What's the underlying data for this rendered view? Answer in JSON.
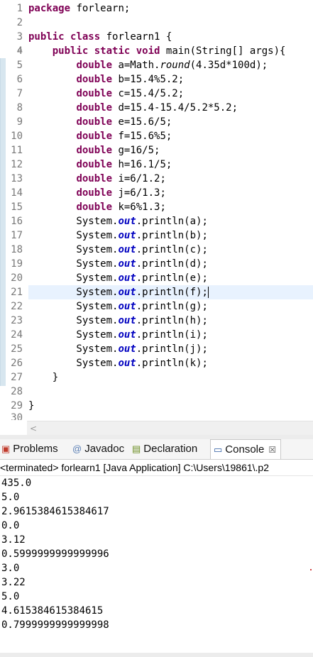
{
  "editor": {
    "line_numbers": [
      "1",
      "2",
      "3",
      "4",
      "5",
      "6",
      "7",
      "8",
      "9",
      "10",
      "11",
      "12",
      "13",
      "14",
      "15",
      "16",
      "17",
      "18",
      "19",
      "20",
      "21",
      "22",
      "23",
      "24",
      "25",
      "26",
      "27",
      "28",
      "29",
      "30"
    ]
  },
  "tabs": {
    "problems": "Problems",
    "javadoc": "Javadoc",
    "declaration": "Declaration",
    "console": "Console",
    "close_glyph": "☒"
  },
  "console": {
    "status": "<terminated> forlearn1 [Java Application] C:\\Users\\19861\\.p2",
    "output": [
      "435.0",
      "5.0",
      "2.9615384615384617",
      "0.0",
      "3.12",
      "0.5999999999999996",
      "3.0",
      "3.22",
      "5.0",
      "4.615384615384615",
      "0.7999999999999998"
    ]
  },
  "hscroll": {
    "arrow": "<"
  }
}
